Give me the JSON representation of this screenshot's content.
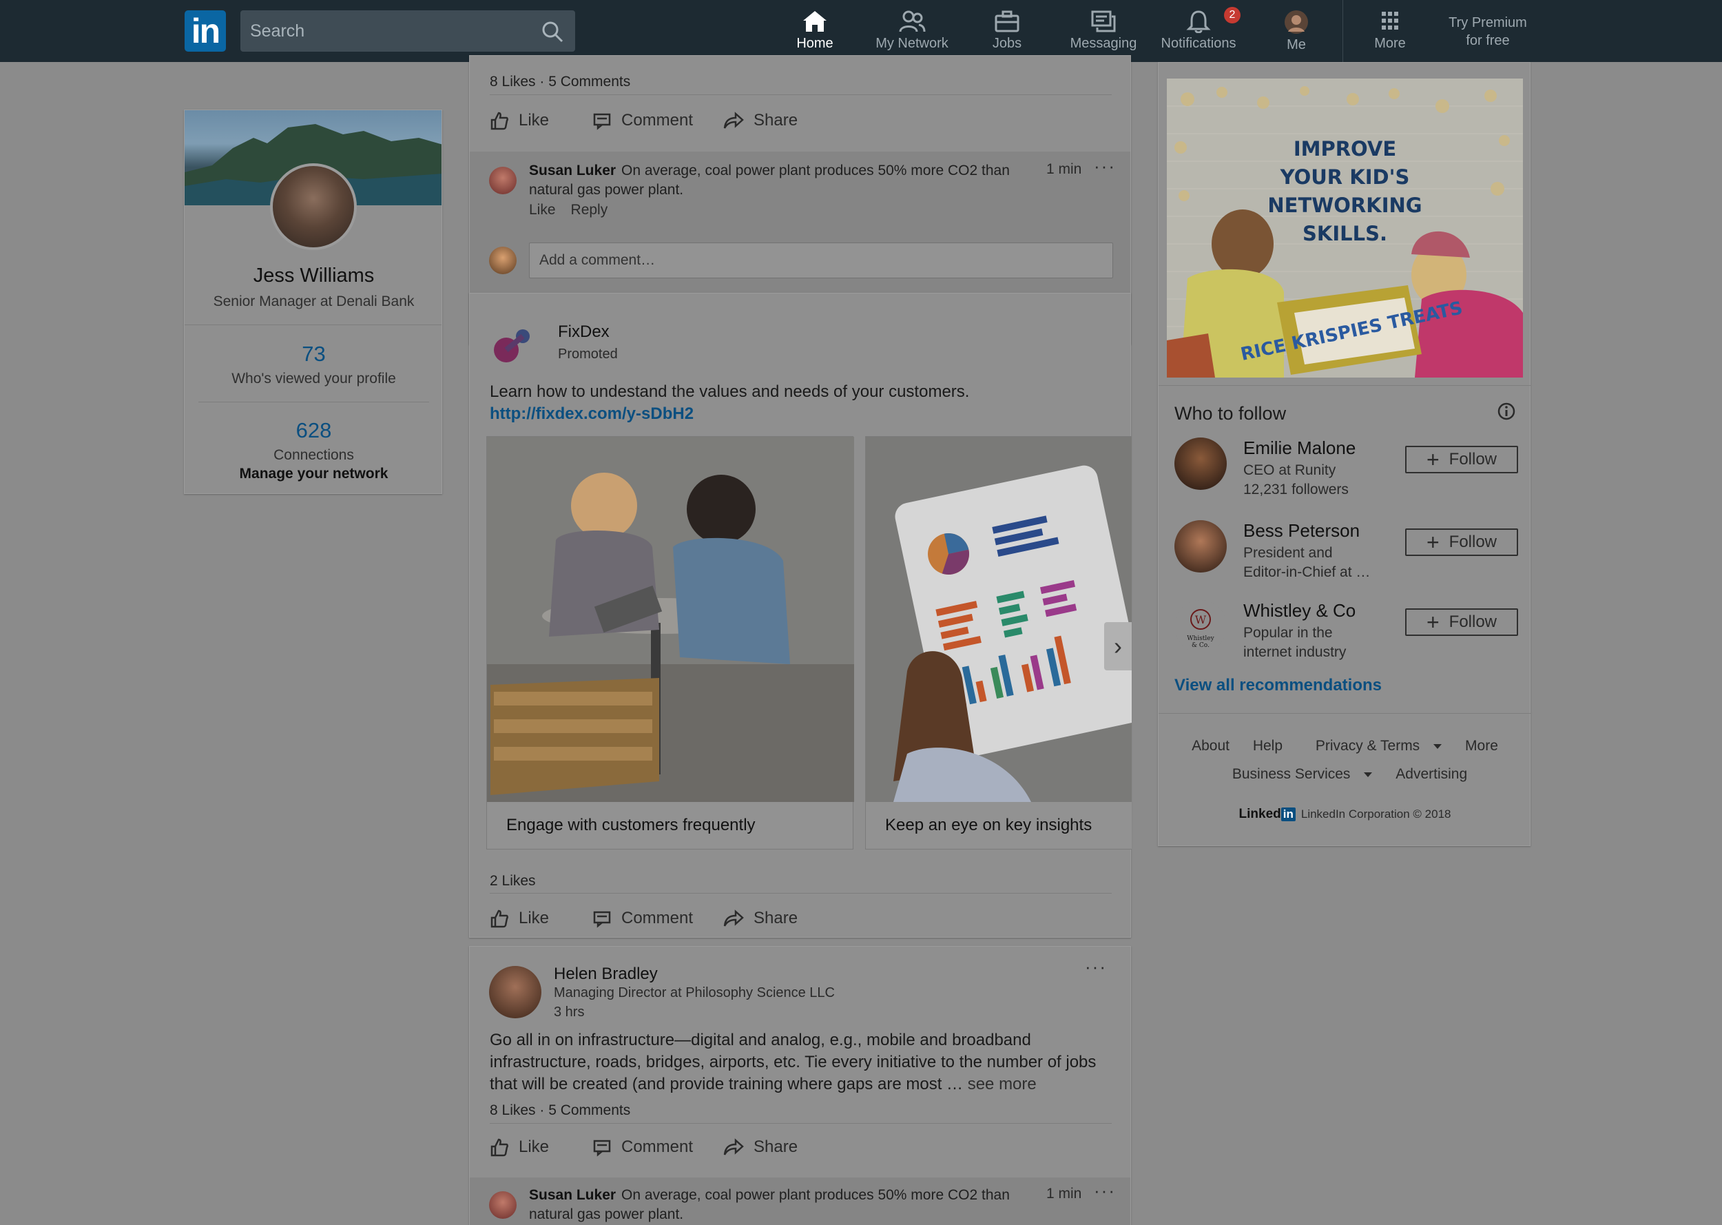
{
  "nav": {
    "logo": "in",
    "search_placeholder": "Search",
    "items": [
      {
        "label": "Home"
      },
      {
        "label": "My Network"
      },
      {
        "label": "Jobs"
      },
      {
        "label": "Messaging"
      },
      {
        "label": "Notifications",
        "badge": "2"
      },
      {
        "label": "Me"
      },
      {
        "label": "More"
      }
    ],
    "premium_line1": "Try Premium",
    "premium_line2": "for free"
  },
  "profile": {
    "name": "Jess Williams",
    "title": "Senior Manager at Denali Bank",
    "views_count": "73",
    "views_label": "Who's viewed your profile",
    "connections_count": "628",
    "connections_label": "Connections",
    "manage_label": "Manage your network"
  },
  "post1": {
    "stats": "8 Likes · 5 Comments",
    "actions": {
      "like": "Like",
      "comment": "Comment",
      "share": "Share"
    },
    "comment": {
      "author": "Susan Luker",
      "text": "On average, coal power plant produces 50% more CO2 than natural gas power plant.",
      "time": "1 min",
      "like": "Like",
      "reply": "Reply"
    },
    "add_comment_placeholder": "Add a comment…"
  },
  "post2": {
    "author": "FixDex",
    "sub": "Promoted",
    "text": "Learn how to undestand the values and needs of your customers.",
    "link": "http://fixdex.com/y-sDbH2",
    "slides": [
      {
        "caption": "Engage with customers frequently"
      },
      {
        "caption": "Keep an eye on key insights"
      }
    ],
    "stats": "2 Likes",
    "actions": {
      "like": "Like",
      "comment": "Comment",
      "share": "Share"
    }
  },
  "post3": {
    "author": "Helen Bradley",
    "headline": "Managing Director at Philosophy Science LLC",
    "time": "3 hrs",
    "text": "Go all in on infrastructure—digital and analog, e.g., mobile and broadband infrastructure, roads, bridges, airports, etc. Tie every initiative to the number of jobs that will be created (and provide training where gaps are most …",
    "see_more": "see more",
    "stats": "8 Likes · 5 Comments",
    "actions": {
      "like": "Like",
      "comment": "Comment",
      "share": "Share"
    },
    "comment": {
      "author": "Susan Luker",
      "text": "On average, coal power plant produces 50% more CO2 than natural gas power plant.",
      "time": "1 min"
    }
  },
  "ad": {
    "line1": "IMPROVE",
    "line2": "YOUR KID'S",
    "line3": "NETWORKING",
    "line4": "SKILLS.",
    "brand": "RICE KRISPIES TREATS"
  },
  "who_to_follow": {
    "title": "Who to follow",
    "people": [
      {
        "name": "Emilie Malone",
        "sub1": "CEO at Runity",
        "sub2": "12,231 followers",
        "button": "Follow"
      },
      {
        "name": "Bess Peterson",
        "sub1": "President and",
        "sub2": "Editor-in-Chief at …",
        "button": "Follow"
      },
      {
        "name": "Whistley & Co",
        "sub1": "Popular in the",
        "sub2": "internet industry",
        "button": "Follow"
      }
    ],
    "view_all": "View all recommendations"
  },
  "footer": {
    "about": "About",
    "help": "Help",
    "privacy": "Privacy & Terms",
    "more": "More",
    "business": "Business Services",
    "advertising": "Advertising",
    "logo_text": "Linked",
    "logo_in": "in",
    "copyright": "LinkedIn Corporation © 2018"
  }
}
